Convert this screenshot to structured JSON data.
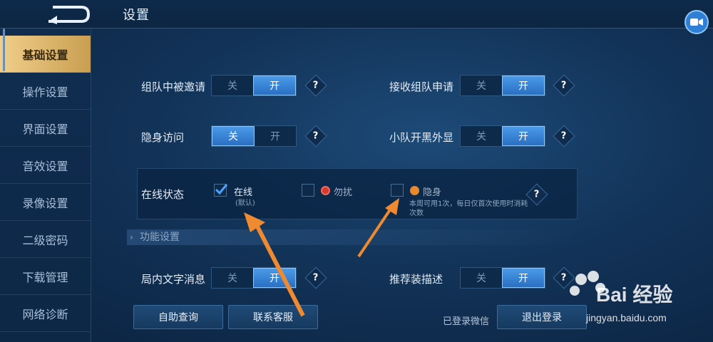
{
  "header": {
    "title": "设置"
  },
  "sidebar": {
    "items": [
      {
        "label": "基础设置",
        "active": true
      },
      {
        "label": "操作设置"
      },
      {
        "label": "界面设置"
      },
      {
        "label": "音效设置"
      },
      {
        "label": "录像设置"
      },
      {
        "label": "二级密码"
      },
      {
        "label": "下载管理"
      },
      {
        "label": "网络诊断"
      }
    ]
  },
  "settings": {
    "team_invite": {
      "label": "组队中被邀请",
      "off": "关",
      "on": "开",
      "value": "开"
    },
    "team_apply": {
      "label": "接收组队申请",
      "off": "关",
      "on": "开",
      "value": "开"
    },
    "stealth_visit": {
      "label": "隐身访问",
      "off": "关",
      "on": "开",
      "value": "关"
    },
    "squad_display": {
      "label": "小队开黑外显",
      "off": "关",
      "on": "开",
      "value": "开"
    },
    "in_game_text": {
      "label": "局内文字消息",
      "off": "关",
      "on": "开",
      "value": "开"
    },
    "recommend_gear": {
      "label": "推荐装描述",
      "off": "关",
      "on": "开",
      "value": "开"
    }
  },
  "online_status": {
    "label": "在线状态",
    "options": [
      {
        "label": "在线",
        "sub": "(默认)",
        "checked": true
      },
      {
        "label": "勿扰",
        "checked": false
      },
      {
        "label": "隐身",
        "sub": "本周可用1次，每日仅首次使用时消耗次数",
        "checked": false
      }
    ]
  },
  "section": {
    "title": "功能设置"
  },
  "help_glyph": "?",
  "bottom": {
    "self_query": "自助查询",
    "contact_support": "联系客服",
    "wechat_status": "已登录微信",
    "logout": "退出登录"
  },
  "watermark": {
    "brand": "Bai 经验",
    "url": "jingyan.baidu.com"
  },
  "colors": {
    "accent_on": "#2a6fc2",
    "active_tab": "#e0b86a",
    "annotation_arrow": "#f08a30"
  }
}
